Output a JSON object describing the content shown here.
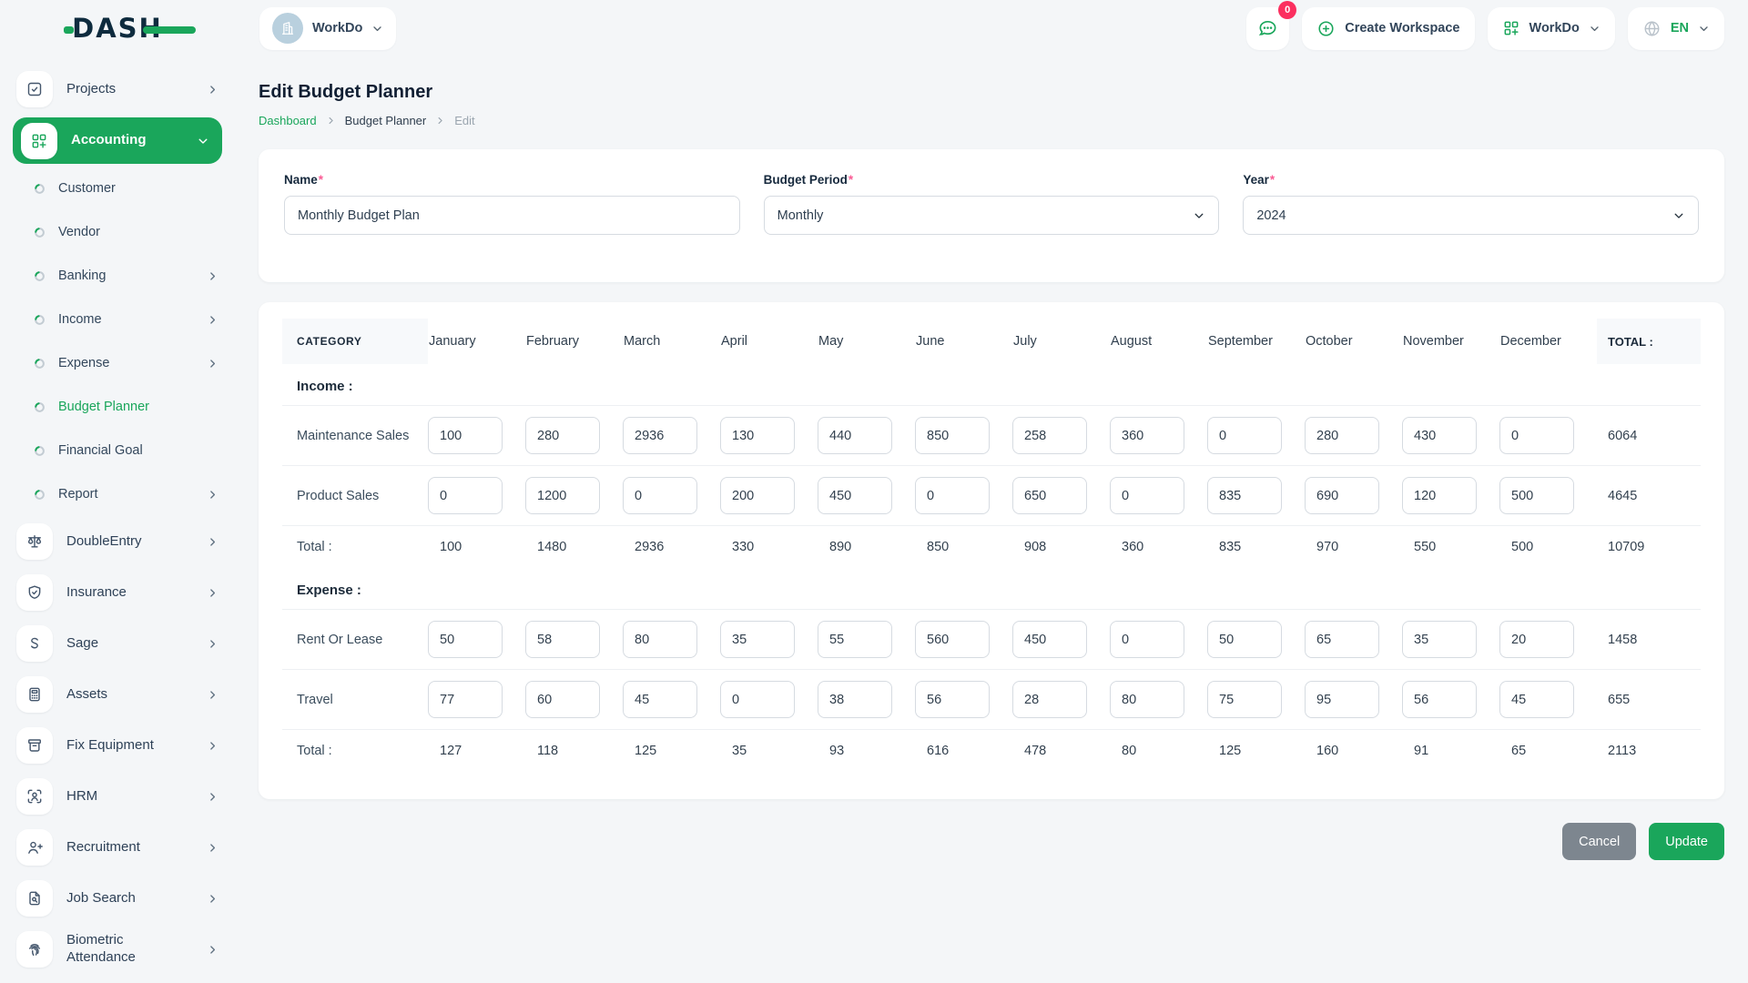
{
  "colors": {
    "primary_green": "#1aa65b",
    "badge_pink": "#fb2f5f",
    "required_pink": "#fa5a93",
    "dark_navy": "#0e2b3e"
  },
  "brand": {
    "logo_text": "DASH"
  },
  "topbar": {
    "workspace_pill": {
      "name": "WorkDo"
    },
    "messages_badge": "0",
    "create_workspace_label": "Create Workspace",
    "workspace_switcher_label": "WorkDo",
    "language_label": "EN"
  },
  "sidebar": {
    "items": [
      {
        "id": "projects",
        "label": "Projects",
        "icon": "checkbox-icon",
        "level": "top",
        "chevron": "right"
      },
      {
        "id": "accounting",
        "label": "Accounting",
        "icon": "grid-plus-icon",
        "level": "top",
        "chevron": "down",
        "active": true
      },
      {
        "id": "customer",
        "label": "Customer",
        "level": "sub"
      },
      {
        "id": "vendor",
        "label": "Vendor",
        "level": "sub"
      },
      {
        "id": "banking",
        "label": "Banking",
        "level": "sub",
        "chevron": "right"
      },
      {
        "id": "income",
        "label": "Income",
        "level": "sub",
        "chevron": "right"
      },
      {
        "id": "expense",
        "label": "Expense",
        "level": "sub",
        "chevron": "right"
      },
      {
        "id": "budget-planner",
        "label": "Budget Planner",
        "level": "sub",
        "active": true
      },
      {
        "id": "financial-goal",
        "label": "Financial Goal",
        "level": "sub"
      },
      {
        "id": "report",
        "label": "Report",
        "level": "sub",
        "chevron": "right"
      },
      {
        "id": "double-entry",
        "label": "DoubleEntry",
        "icon": "scale-icon",
        "level": "top",
        "chevron": "right"
      },
      {
        "id": "insurance",
        "label": "Insurance",
        "icon": "shield-icon",
        "level": "top",
        "chevron": "right"
      },
      {
        "id": "sage",
        "label": "Sage",
        "icon": "sage-icon",
        "level": "top",
        "chevron": "right"
      },
      {
        "id": "assets",
        "label": "Assets",
        "icon": "calculator-icon",
        "level": "top",
        "chevron": "right"
      },
      {
        "id": "fix-equipment",
        "label": "Fix Equipment",
        "icon": "archive-icon",
        "level": "top",
        "chevron": "right"
      },
      {
        "id": "hrm",
        "label": "HRM",
        "icon": "user-focus-icon",
        "level": "top",
        "chevron": "right"
      },
      {
        "id": "recruitment",
        "label": "Recruitment",
        "icon": "user-plus-icon",
        "level": "top",
        "chevron": "right"
      },
      {
        "id": "job-search",
        "label": "Job Search",
        "icon": "file-search-icon",
        "level": "top",
        "chevron": "right"
      },
      {
        "id": "biometric-attendance",
        "label": "Biometric Attendance",
        "icon": "fingerprint-icon",
        "level": "top",
        "chevron": "right"
      }
    ]
  },
  "page": {
    "title": "Edit Budget Planner",
    "breadcrumb": {
      "dashboard": "Dashboard",
      "section": "Budget Planner",
      "current": "Edit"
    }
  },
  "form": {
    "required_marker": "*",
    "name": {
      "label": "Name",
      "value": "Monthly Budget Plan"
    },
    "budget_period": {
      "label": "Budget Period",
      "value": "Monthly"
    },
    "year": {
      "label": "Year",
      "value": "2024"
    }
  },
  "table": {
    "category_header": "CATEGORY",
    "months": [
      "January",
      "February",
      "March",
      "April",
      "May",
      "June",
      "July",
      "August",
      "September",
      "October",
      "November",
      "December"
    ],
    "total_header": "TOTAL :",
    "sections": [
      {
        "label": "Income :",
        "rows": [
          {
            "label": "Maintenance Sales",
            "values": [
              100,
              280,
              2936,
              130,
              440,
              850,
              258,
              360,
              0,
              280,
              430,
              0
            ],
            "total": 6064
          },
          {
            "label": "Product Sales",
            "values": [
              0,
              1200,
              0,
              200,
              450,
              0,
              650,
              0,
              835,
              690,
              120,
              500
            ],
            "total": 4645
          }
        ],
        "total_row": {
          "label": "Total :",
          "values": [
            100,
            1480,
            2936,
            330,
            890,
            850,
            908,
            360,
            835,
            970,
            550,
            500
          ],
          "total": 10709
        }
      },
      {
        "label": "Expense :",
        "rows": [
          {
            "label": "Rent Or Lease",
            "values": [
              50,
              58,
              80,
              35,
              55,
              560,
              450,
              0,
              50,
              65,
              35,
              20
            ],
            "total": 1458
          },
          {
            "label": "Travel",
            "values": [
              77,
              60,
              45,
              0,
              38,
              56,
              28,
              80,
              75,
              95,
              56,
              45
            ],
            "total": 655
          }
        ],
        "total_row": {
          "label": "Total :",
          "values": [
            127,
            118,
            125,
            35,
            93,
            616,
            478,
            80,
            125,
            160,
            91,
            65
          ],
          "total": 2113
        }
      }
    ]
  },
  "actions": {
    "cancel_label": "Cancel",
    "update_label": "Update"
  }
}
